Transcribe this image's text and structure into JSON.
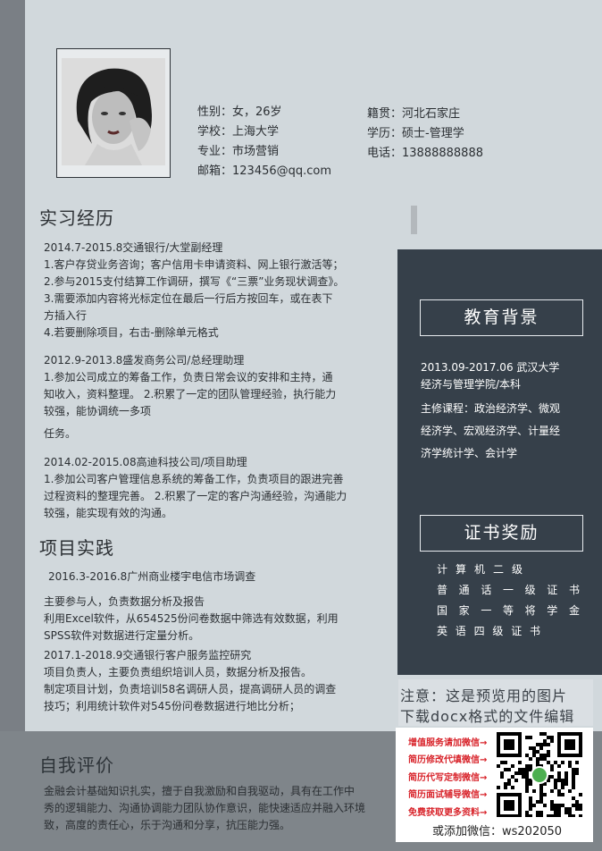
{
  "personal": {
    "gender_age": "性别：女，26岁",
    "school": "学校：上海大学",
    "major": "专业：市场营销",
    "email": "邮箱：123456@qq.com",
    "hometown": "籍贯：河北石家庄",
    "degree": "学历：硕士-管理学",
    "phone": "电话：13888888888"
  },
  "internship": {
    "title": "实习经历",
    "entries": [
      {
        "header": "2014.7-2015.8交通银行/大堂副经理",
        "lines": [
          "1.客户存贷业务咨询；客户信用卡申请资料、网上银行激活等；",
          "2.参与2015支付结算工作调研，撰写《“三票”业务现状调查》。",
          "3.需要添加内容将光标定位在最后一行后方按回车，或在表下",
          "方插入行",
          "4.若要删除项目，右击-删除单元格式"
        ]
      },
      {
        "header": "2012.9-2013.8盛发商务公司/总经理助理",
        "lines": [
          "1.参加公司成立的筹备工作，负责日常会议的安排和主持，通",
          "知收入，资料整理。 2.积累了一定的团队管理经验，执行能力",
          "较强，能协调统一多项",
          "任务。"
        ]
      },
      {
        "header": "2014.02-2015.08高迪科技公司/项目助理",
        "lines": [
          "1.参加公司客户管理信息系统的筹备工作，负责项目的跟进完善",
          "过程资料的整理完善。 2.积累了一定的客户沟通经验，沟通能力",
          "较强，能实现有效的沟通。"
        ]
      }
    ]
  },
  "projects": {
    "title": "项目实践",
    "entries": [
      {
        "header": "2016.3-2016.8广州商业楼宇电信市场调查",
        "lines": [
          "主要参与人，负责数据分析及报告",
          "利用Excel软件，从654525份问卷数据中筛选有效数据，利用",
          "SPSS软件对数据进行定量分析。"
        ]
      },
      {
        "header": "2017.1-2018.9交通银行客户服务监控研究",
        "lines": [
          "项目负责人，主要负责组织培训人员，数据分析及报告。",
          "制定项目计划，负责培训58名调研人员，提高调研人员的调查",
          "技巧；利用统计软件对545份问卷数据进行地比分析；"
        ]
      }
    ]
  },
  "self_eval": {
    "title": "自我评价",
    "lines": [
      "金融会计基础知识扎实，擅于自我激励和自我驱动，具有在工作中",
      "秀的逻辑能力、沟通协调能力团队协作意识，能快速适应并融入环境",
      "致，高度的责任心，乐于沟通和分享，抗压能力强。"
    ]
  },
  "education": {
    "title": "教育背景",
    "period_school": "2013.09-2017.06    武汉大学",
    "college": "经济与管理学院/本科",
    "courses_lines": [
      "主修课程：政治经济学、微观",
      "经济学、宏观经济学、计量经",
      "济学统计学、会计学"
    ]
  },
  "certificates": {
    "title": "证书奖励",
    "items": [
      [
        "计",
        "算",
        "机",
        "二",
        "级"
      ],
      [
        "普",
        "通",
        "话",
        "一",
        "级",
        "证",
        "书"
      ],
      [
        "国",
        "家",
        "一",
        "等",
        "将",
        "学",
        "金"
      ],
      [
        "英",
        "语",
        "四",
        "级",
        "证",
        "书"
      ]
    ]
  },
  "notice": {
    "line1": "注意：这是预览用的图片",
    "line2": "下载docx格式的文件编辑"
  },
  "promo": {
    "items": [
      "增值服务请加微信→",
      "简历修改代填微信→",
      "简历代写定制微信→",
      "简历面试辅导微信→",
      "免费获取更多资料→"
    ],
    "wechat": "或添加微信：ws202050"
  },
  "colors": {
    "sidebar": "#36404a",
    "paper": "#d1d8dc",
    "promo_red": "#d8232a"
  }
}
